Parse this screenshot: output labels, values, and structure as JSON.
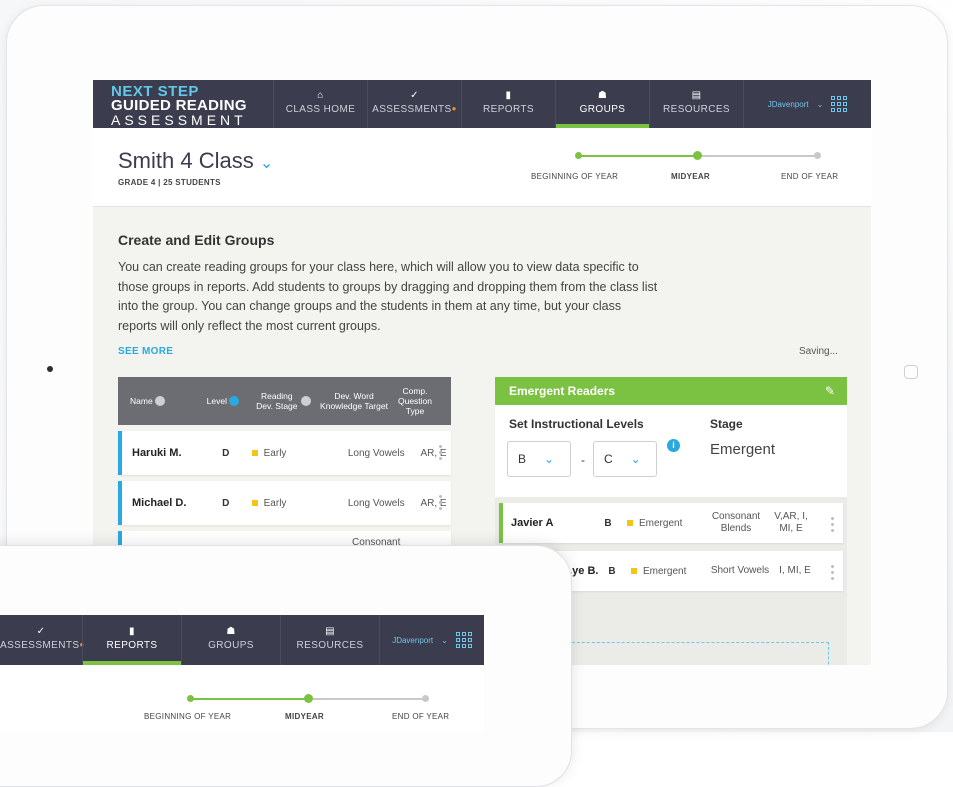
{
  "nav": {
    "logo": {
      "line1": "NEXT STEP",
      "line2": "GUIDED READING",
      "line3": "ASSESSMENT"
    },
    "items": [
      {
        "label": "CLASS HOME",
        "icon": "home-icon"
      },
      {
        "label": "ASSESSMENTS",
        "icon": "check-icon"
      },
      {
        "label": "REPORTS",
        "icon": "bar-chart-icon"
      },
      {
        "label": "GROUPS",
        "icon": "users-icon"
      },
      {
        "label": "RESOURCES",
        "icon": "document-icon"
      }
    ],
    "active": "GROUPS",
    "user": "JDavenport",
    "accent": "#7bc142",
    "nav_bg": "#3b3c4d"
  },
  "header": {
    "class_name": "Smith 4 Class",
    "subtitle": "GRADE 4 | 25 STUDENTS",
    "timeline": [
      "BEGINNING OF YEAR",
      "MIDYEAR",
      "END OF YEAR"
    ],
    "current": "MIDYEAR"
  },
  "content": {
    "title": "Create and Edit Groups",
    "description": "You can create reading groups for your class here, which will allow you to view data specific to those groups in reports. Add students to groups by dragging and dropping them from the class list into the group. You can change groups and the students in them at any time, but your class reports will only reflect the most current groups.",
    "see_more": "SEE MORE",
    "status": "Saving..."
  },
  "class_table": {
    "headers": {
      "name": "Name",
      "level": "Level",
      "stage": "Reading Dev. Stage",
      "target": "Dev. Word Knowledge Target",
      "qtype": "Comp. Question Type"
    },
    "rows": [
      {
        "name": "Haruki M.",
        "level": "D",
        "stage": "Early",
        "target": "Long Vowels",
        "qtype": "AR, E"
      },
      {
        "name": "Michael D.",
        "level": "D",
        "stage": "Early",
        "target": "Long Vowels",
        "qtype": "AR, E"
      },
      {
        "name": "",
        "level": "",
        "stage": "",
        "target": "Consonant",
        "qtype": ""
      }
    ]
  },
  "group": {
    "name": "Emergent Readers",
    "set_levels_label": "Set Instructional Levels",
    "level_from": "B",
    "level_to": "C",
    "stage_label": "Stage",
    "stage_value": "Emergent",
    "members": [
      {
        "name": "Javier A",
        "level": "B",
        "stage": "Emergent",
        "target": "Consonant Blends",
        "qtype": "V,AR, I, MI, E"
      },
      {
        "name": "...ye B.",
        "level": "B",
        "stage": "Emergent",
        "target": "Short Vowels",
        "qtype": "I, MI, E"
      }
    ],
    "color": "#7bc142"
  },
  "front": {
    "nav_items": [
      {
        "label": "ASSESSMENTS",
        "icon": "check-icon"
      },
      {
        "label": "REPORTS",
        "icon": "bar-chart-icon"
      },
      {
        "label": "GROUPS",
        "icon": "users-icon"
      },
      {
        "label": "RESOURCES",
        "icon": "document-icon"
      }
    ],
    "active": "REPORTS",
    "user": "JDavenport",
    "timeline": [
      "BEGINNING OF YEAR",
      "MIDYEAR",
      "END OF YEAR"
    ]
  }
}
